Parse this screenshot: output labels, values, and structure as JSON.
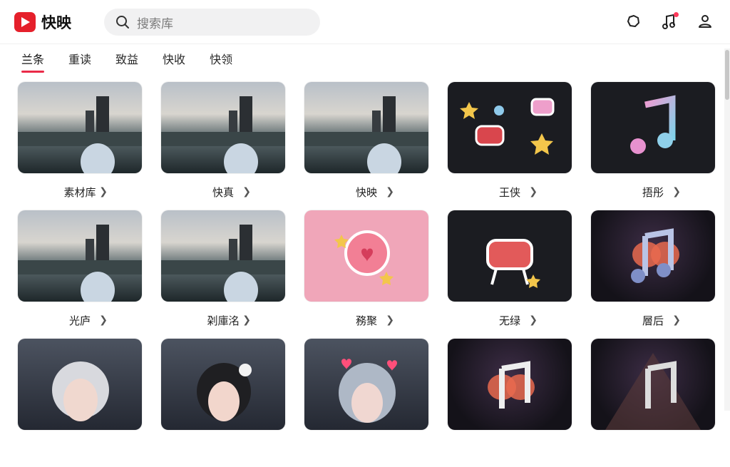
{
  "app": {
    "name": "快映"
  },
  "search": {
    "placeholder": "搜索库"
  },
  "tabs": [
    {
      "label": "兰条"
    },
    {
      "label": "重读"
    },
    {
      "label": "致益"
    },
    {
      "label": "快收"
    },
    {
      "label": "快领"
    }
  ],
  "grid": {
    "items": [
      {
        "label": "素材库",
        "thumb": "photo"
      },
      {
        "label": "快真",
        "thumb": "photo"
      },
      {
        "label": "快映",
        "thumb": "photo"
      },
      {
        "label": "王侠",
        "thumb": "stickers"
      },
      {
        "label": "捂彤",
        "thumb": "music"
      },
      {
        "label": "光庐",
        "thumb": "photo"
      },
      {
        "label": "刴庫洺",
        "thumb": "photo"
      },
      {
        "label": "務聚",
        "thumb": "apple-sticker"
      },
      {
        "label": "无绿",
        "thumb": "pot-sticker"
      },
      {
        "label": "層后",
        "thumb": "music"
      },
      {
        "label": "",
        "thumb": "person"
      },
      {
        "label": "",
        "thumb": "person"
      },
      {
        "label": "",
        "thumb": "person"
      },
      {
        "label": "",
        "thumb": "music"
      },
      {
        "label": "",
        "thumb": "music"
      }
    ]
  },
  "icons": {
    "search": "search-icon",
    "chat": "chat-bubble-icon",
    "music": "music-note-icon",
    "profile": "user-icon",
    "chevron": "chevron-right-icon"
  },
  "colors": {
    "brand": "#e5202b",
    "accent": "#ea2b48",
    "notification": "#ff3b5c"
  }
}
